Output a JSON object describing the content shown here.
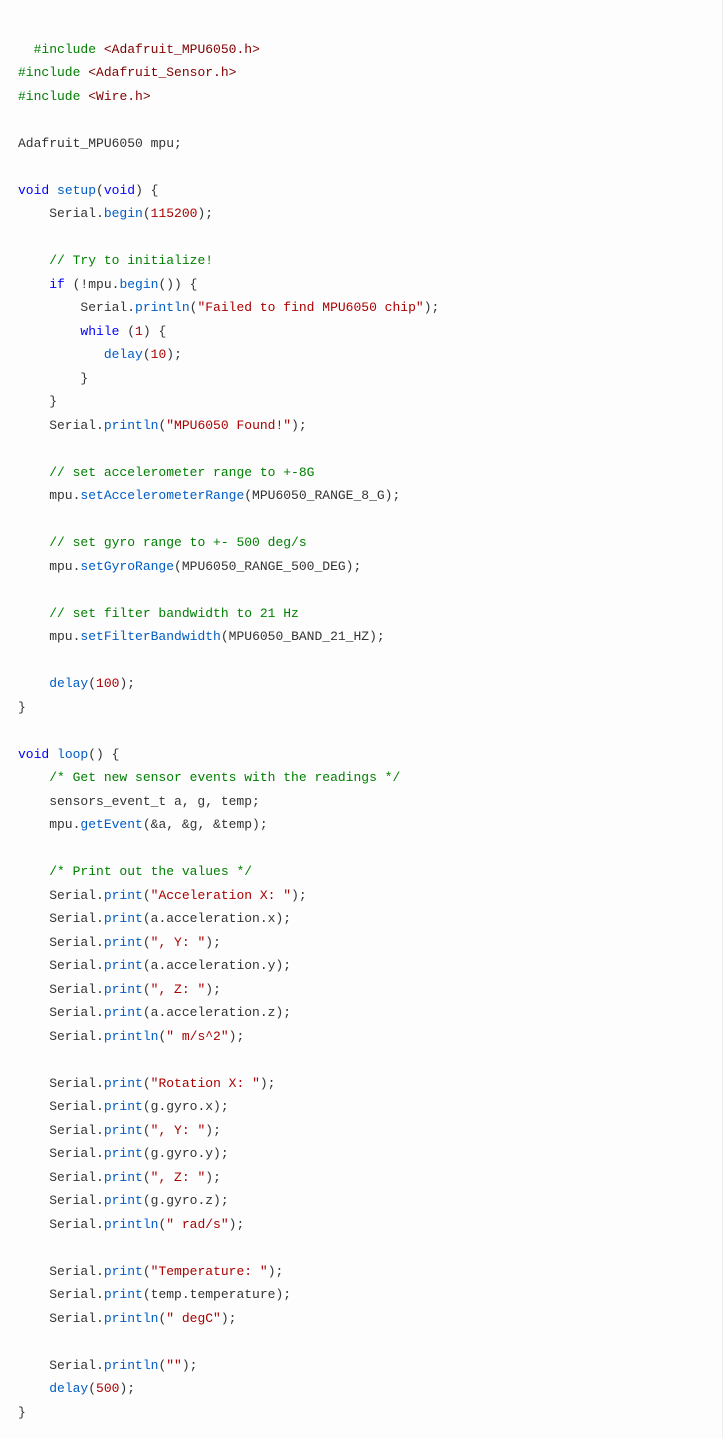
{
  "code": {
    "lines": [
      [
        {
          "cls": "tok-macro",
          "t": "#include"
        },
        {
          "cls": "tok-plain",
          "t": " "
        },
        {
          "cls": "tok-include",
          "t": "<Adafruit_MPU6050.h>"
        }
      ],
      [
        {
          "cls": "tok-macro",
          "t": "#include"
        },
        {
          "cls": "tok-plain",
          "t": " "
        },
        {
          "cls": "tok-include",
          "t": "<Adafruit_Sensor.h>"
        }
      ],
      [
        {
          "cls": "tok-macro",
          "t": "#include"
        },
        {
          "cls": "tok-plain",
          "t": " "
        },
        {
          "cls": "tok-include",
          "t": "<Wire.h>"
        }
      ],
      [],
      [
        {
          "cls": "tok-plain",
          "t": "Adafruit_MPU6050 mpu;"
        }
      ],
      [],
      [
        {
          "cls": "tok-type",
          "t": "void"
        },
        {
          "cls": "tok-plain",
          "t": " "
        },
        {
          "cls": "tok-call",
          "t": "setup"
        },
        {
          "cls": "tok-plain",
          "t": "("
        },
        {
          "cls": "tok-type",
          "t": "void"
        },
        {
          "cls": "tok-plain",
          "t": ") {"
        }
      ],
      [
        {
          "cls": "tok-plain",
          "t": "    Serial."
        },
        {
          "cls": "tok-call",
          "t": "begin"
        },
        {
          "cls": "tok-plain",
          "t": "("
        },
        {
          "cls": "tok-num",
          "t": "115200"
        },
        {
          "cls": "tok-plain",
          "t": ");"
        }
      ],
      [],
      [
        {
          "cls": "tok-plain",
          "t": "    "
        },
        {
          "cls": "tok-comment",
          "t": "// Try to initialize!"
        }
      ],
      [
        {
          "cls": "tok-plain",
          "t": "    "
        },
        {
          "cls": "tok-kw",
          "t": "if"
        },
        {
          "cls": "tok-plain",
          "t": " (!mpu."
        },
        {
          "cls": "tok-call",
          "t": "begin"
        },
        {
          "cls": "tok-plain",
          "t": "()) {"
        }
      ],
      [
        {
          "cls": "tok-plain",
          "t": "        Serial."
        },
        {
          "cls": "tok-call",
          "t": "println"
        },
        {
          "cls": "tok-plain",
          "t": "("
        },
        {
          "cls": "tok-str",
          "t": "\"Failed to find MPU6050 chip\""
        },
        {
          "cls": "tok-plain",
          "t": ");"
        }
      ],
      [
        {
          "cls": "tok-plain",
          "t": "        "
        },
        {
          "cls": "tok-kw",
          "t": "while"
        },
        {
          "cls": "tok-plain",
          "t": " ("
        },
        {
          "cls": "tok-num",
          "t": "1"
        },
        {
          "cls": "tok-plain",
          "t": ") {"
        }
      ],
      [
        {
          "cls": "tok-plain",
          "t": "           "
        },
        {
          "cls": "tok-call",
          "t": "delay"
        },
        {
          "cls": "tok-plain",
          "t": "("
        },
        {
          "cls": "tok-num",
          "t": "10"
        },
        {
          "cls": "tok-plain",
          "t": ");"
        }
      ],
      [
        {
          "cls": "tok-plain",
          "t": "        }"
        }
      ],
      [
        {
          "cls": "tok-plain",
          "t": "    }"
        }
      ],
      [
        {
          "cls": "tok-plain",
          "t": "    Serial."
        },
        {
          "cls": "tok-call",
          "t": "println"
        },
        {
          "cls": "tok-plain",
          "t": "("
        },
        {
          "cls": "tok-str",
          "t": "\"MPU6050 Found!\""
        },
        {
          "cls": "tok-plain",
          "t": ");"
        }
      ],
      [],
      [
        {
          "cls": "tok-plain",
          "t": "    "
        },
        {
          "cls": "tok-comment",
          "t": "// set accelerometer range to +-8G"
        }
      ],
      [
        {
          "cls": "tok-plain",
          "t": "    mpu."
        },
        {
          "cls": "tok-call",
          "t": "setAccelerometerRange"
        },
        {
          "cls": "tok-plain",
          "t": "(MPU6050_RANGE_8_G);"
        }
      ],
      [],
      [
        {
          "cls": "tok-plain",
          "t": "    "
        },
        {
          "cls": "tok-comment",
          "t": "// set gyro range to +- 500 deg/s"
        }
      ],
      [
        {
          "cls": "tok-plain",
          "t": "    mpu."
        },
        {
          "cls": "tok-call",
          "t": "setGyroRange"
        },
        {
          "cls": "tok-plain",
          "t": "(MPU6050_RANGE_500_DEG);"
        }
      ],
      [],
      [
        {
          "cls": "tok-plain",
          "t": "    "
        },
        {
          "cls": "tok-comment",
          "t": "// set filter bandwidth to 21 Hz"
        }
      ],
      [
        {
          "cls": "tok-plain",
          "t": "    mpu."
        },
        {
          "cls": "tok-call",
          "t": "setFilterBandwidth"
        },
        {
          "cls": "tok-plain",
          "t": "(MPU6050_BAND_21_HZ);"
        }
      ],
      [],
      [
        {
          "cls": "tok-plain",
          "t": "    "
        },
        {
          "cls": "tok-call",
          "t": "delay"
        },
        {
          "cls": "tok-plain",
          "t": "("
        },
        {
          "cls": "tok-num",
          "t": "100"
        },
        {
          "cls": "tok-plain",
          "t": ");"
        }
      ],
      [
        {
          "cls": "tok-plain",
          "t": "}"
        }
      ],
      [],
      [
        {
          "cls": "tok-type",
          "t": "void"
        },
        {
          "cls": "tok-plain",
          "t": " "
        },
        {
          "cls": "tok-call",
          "t": "loop"
        },
        {
          "cls": "tok-plain",
          "t": "() {"
        }
      ],
      [
        {
          "cls": "tok-plain",
          "t": "    "
        },
        {
          "cls": "tok-comment",
          "t": "/* Get new sensor events with the readings */"
        }
      ],
      [
        {
          "cls": "tok-plain",
          "t": "    sensors_event_t a, g, temp;"
        }
      ],
      [
        {
          "cls": "tok-plain",
          "t": "    mpu."
        },
        {
          "cls": "tok-call",
          "t": "getEvent"
        },
        {
          "cls": "tok-plain",
          "t": "(&a, &g, &temp);"
        }
      ],
      [],
      [
        {
          "cls": "tok-plain",
          "t": "    "
        },
        {
          "cls": "tok-comment",
          "t": "/* Print out the values */"
        }
      ],
      [
        {
          "cls": "tok-plain",
          "t": "    Serial."
        },
        {
          "cls": "tok-call",
          "t": "print"
        },
        {
          "cls": "tok-plain",
          "t": "("
        },
        {
          "cls": "tok-str",
          "t": "\"Acceleration X: \""
        },
        {
          "cls": "tok-plain",
          "t": ");"
        }
      ],
      [
        {
          "cls": "tok-plain",
          "t": "    Serial."
        },
        {
          "cls": "tok-call",
          "t": "print"
        },
        {
          "cls": "tok-plain",
          "t": "(a.acceleration.x);"
        }
      ],
      [
        {
          "cls": "tok-plain",
          "t": "    Serial."
        },
        {
          "cls": "tok-call",
          "t": "print"
        },
        {
          "cls": "tok-plain",
          "t": "("
        },
        {
          "cls": "tok-str",
          "t": "\", Y: \""
        },
        {
          "cls": "tok-plain",
          "t": ");"
        }
      ],
      [
        {
          "cls": "tok-plain",
          "t": "    Serial."
        },
        {
          "cls": "tok-call",
          "t": "print"
        },
        {
          "cls": "tok-plain",
          "t": "(a.acceleration.y);"
        }
      ],
      [
        {
          "cls": "tok-plain",
          "t": "    Serial."
        },
        {
          "cls": "tok-call",
          "t": "print"
        },
        {
          "cls": "tok-plain",
          "t": "("
        },
        {
          "cls": "tok-str",
          "t": "\", Z: \""
        },
        {
          "cls": "tok-plain",
          "t": ");"
        }
      ],
      [
        {
          "cls": "tok-plain",
          "t": "    Serial."
        },
        {
          "cls": "tok-call",
          "t": "print"
        },
        {
          "cls": "tok-plain",
          "t": "(a.acceleration.z);"
        }
      ],
      [
        {
          "cls": "tok-plain",
          "t": "    Serial."
        },
        {
          "cls": "tok-call",
          "t": "println"
        },
        {
          "cls": "tok-plain",
          "t": "("
        },
        {
          "cls": "tok-str",
          "t": "\" m/s^2\""
        },
        {
          "cls": "tok-plain",
          "t": ");"
        }
      ],
      [],
      [
        {
          "cls": "tok-plain",
          "t": "    Serial."
        },
        {
          "cls": "tok-call",
          "t": "print"
        },
        {
          "cls": "tok-plain",
          "t": "("
        },
        {
          "cls": "tok-str",
          "t": "\"Rotation X: \""
        },
        {
          "cls": "tok-plain",
          "t": ");"
        }
      ],
      [
        {
          "cls": "tok-plain",
          "t": "    Serial."
        },
        {
          "cls": "tok-call",
          "t": "print"
        },
        {
          "cls": "tok-plain",
          "t": "(g.gyro.x);"
        }
      ],
      [
        {
          "cls": "tok-plain",
          "t": "    Serial."
        },
        {
          "cls": "tok-call",
          "t": "print"
        },
        {
          "cls": "tok-plain",
          "t": "("
        },
        {
          "cls": "tok-str",
          "t": "\", Y: \""
        },
        {
          "cls": "tok-plain",
          "t": ");"
        }
      ],
      [
        {
          "cls": "tok-plain",
          "t": "    Serial."
        },
        {
          "cls": "tok-call",
          "t": "print"
        },
        {
          "cls": "tok-plain",
          "t": "(g.gyro.y);"
        }
      ],
      [
        {
          "cls": "tok-plain",
          "t": "    Serial."
        },
        {
          "cls": "tok-call",
          "t": "print"
        },
        {
          "cls": "tok-plain",
          "t": "("
        },
        {
          "cls": "tok-str",
          "t": "\", Z: \""
        },
        {
          "cls": "tok-plain",
          "t": ");"
        }
      ],
      [
        {
          "cls": "tok-plain",
          "t": "    Serial."
        },
        {
          "cls": "tok-call",
          "t": "print"
        },
        {
          "cls": "tok-plain",
          "t": "(g.gyro.z);"
        }
      ],
      [
        {
          "cls": "tok-plain",
          "t": "    Serial."
        },
        {
          "cls": "tok-call",
          "t": "println"
        },
        {
          "cls": "tok-plain",
          "t": "("
        },
        {
          "cls": "tok-str",
          "t": "\" rad/s\""
        },
        {
          "cls": "tok-plain",
          "t": ");"
        }
      ],
      [],
      [
        {
          "cls": "tok-plain",
          "t": "    Serial."
        },
        {
          "cls": "tok-call",
          "t": "print"
        },
        {
          "cls": "tok-plain",
          "t": "("
        },
        {
          "cls": "tok-str",
          "t": "\"Temperature: \""
        },
        {
          "cls": "tok-plain",
          "t": ");"
        }
      ],
      [
        {
          "cls": "tok-plain",
          "t": "    Serial."
        },
        {
          "cls": "tok-call",
          "t": "print"
        },
        {
          "cls": "tok-plain",
          "t": "(temp.temperature);"
        }
      ],
      [
        {
          "cls": "tok-plain",
          "t": "    Serial."
        },
        {
          "cls": "tok-call",
          "t": "println"
        },
        {
          "cls": "tok-plain",
          "t": "("
        },
        {
          "cls": "tok-str",
          "t": "\" degC\""
        },
        {
          "cls": "tok-plain",
          "t": ");"
        }
      ],
      [],
      [
        {
          "cls": "tok-plain",
          "t": "    Serial."
        },
        {
          "cls": "tok-call",
          "t": "println"
        },
        {
          "cls": "tok-plain",
          "t": "("
        },
        {
          "cls": "tok-str",
          "t": "\"\""
        },
        {
          "cls": "tok-plain",
          "t": ");"
        }
      ],
      [
        {
          "cls": "tok-plain",
          "t": "    "
        },
        {
          "cls": "tok-call",
          "t": "delay"
        },
        {
          "cls": "tok-plain",
          "t": "("
        },
        {
          "cls": "tok-num",
          "t": "500"
        },
        {
          "cls": "tok-plain",
          "t": ");"
        }
      ],
      [
        {
          "cls": "tok-plain",
          "t": "}"
        }
      ]
    ]
  }
}
